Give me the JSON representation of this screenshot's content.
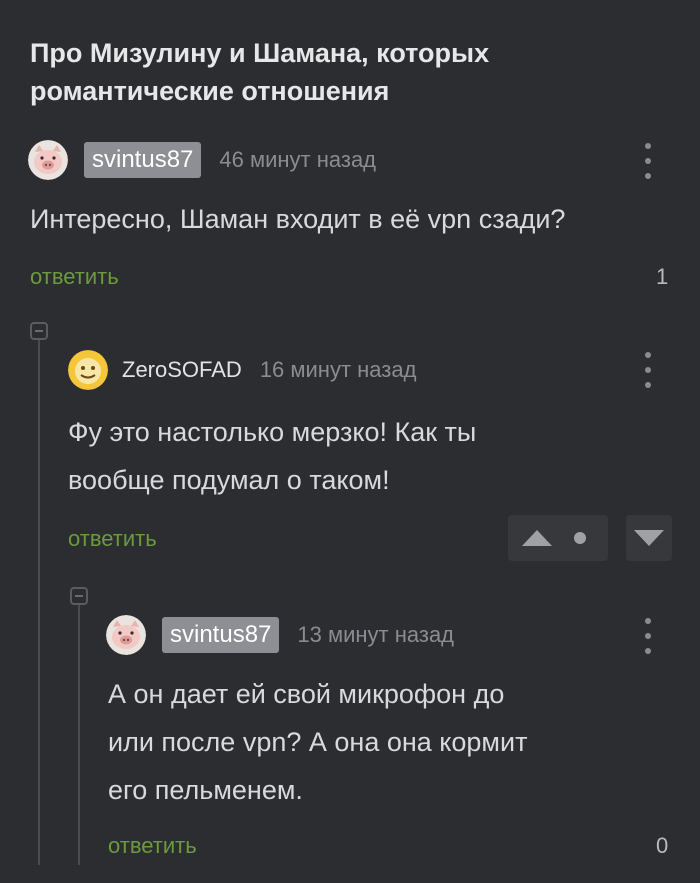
{
  "post": {
    "title": "Про Мизулину и Шамана, которых романтические отношения"
  },
  "comments": [
    {
      "author": "svintus87",
      "time": "46 минут назад",
      "text": "Интересно, Шаман входит в её vpn сзади?",
      "reply_label": "ответить",
      "rating": "1",
      "avatar_icon": "pig-avatar-icon"
    },
    {
      "author": "ZeroSOFAD",
      "time": "16 минут назад",
      "text_lines": [
        "Фу это настолько мерзко! Как ты",
        "вообще подумал о таком!"
      ],
      "reply_label": "ответить",
      "avatar_icon": "emoji-avatar-icon"
    },
    {
      "author": "svintus87",
      "time": "13 минут назад",
      "text_lines": [
        "А он дает ей свой микрофон до",
        "или после vpn? А она она кормит",
        "его пельменем."
      ],
      "reply_label": "ответить",
      "rating": "0",
      "avatar_icon": "pig-avatar-icon"
    }
  ],
  "colors": {
    "background": "#2b2d30",
    "reply_link": "#6c9a3e",
    "author_badge": "#8d8f94",
    "muted_text": "#8a8c91"
  }
}
